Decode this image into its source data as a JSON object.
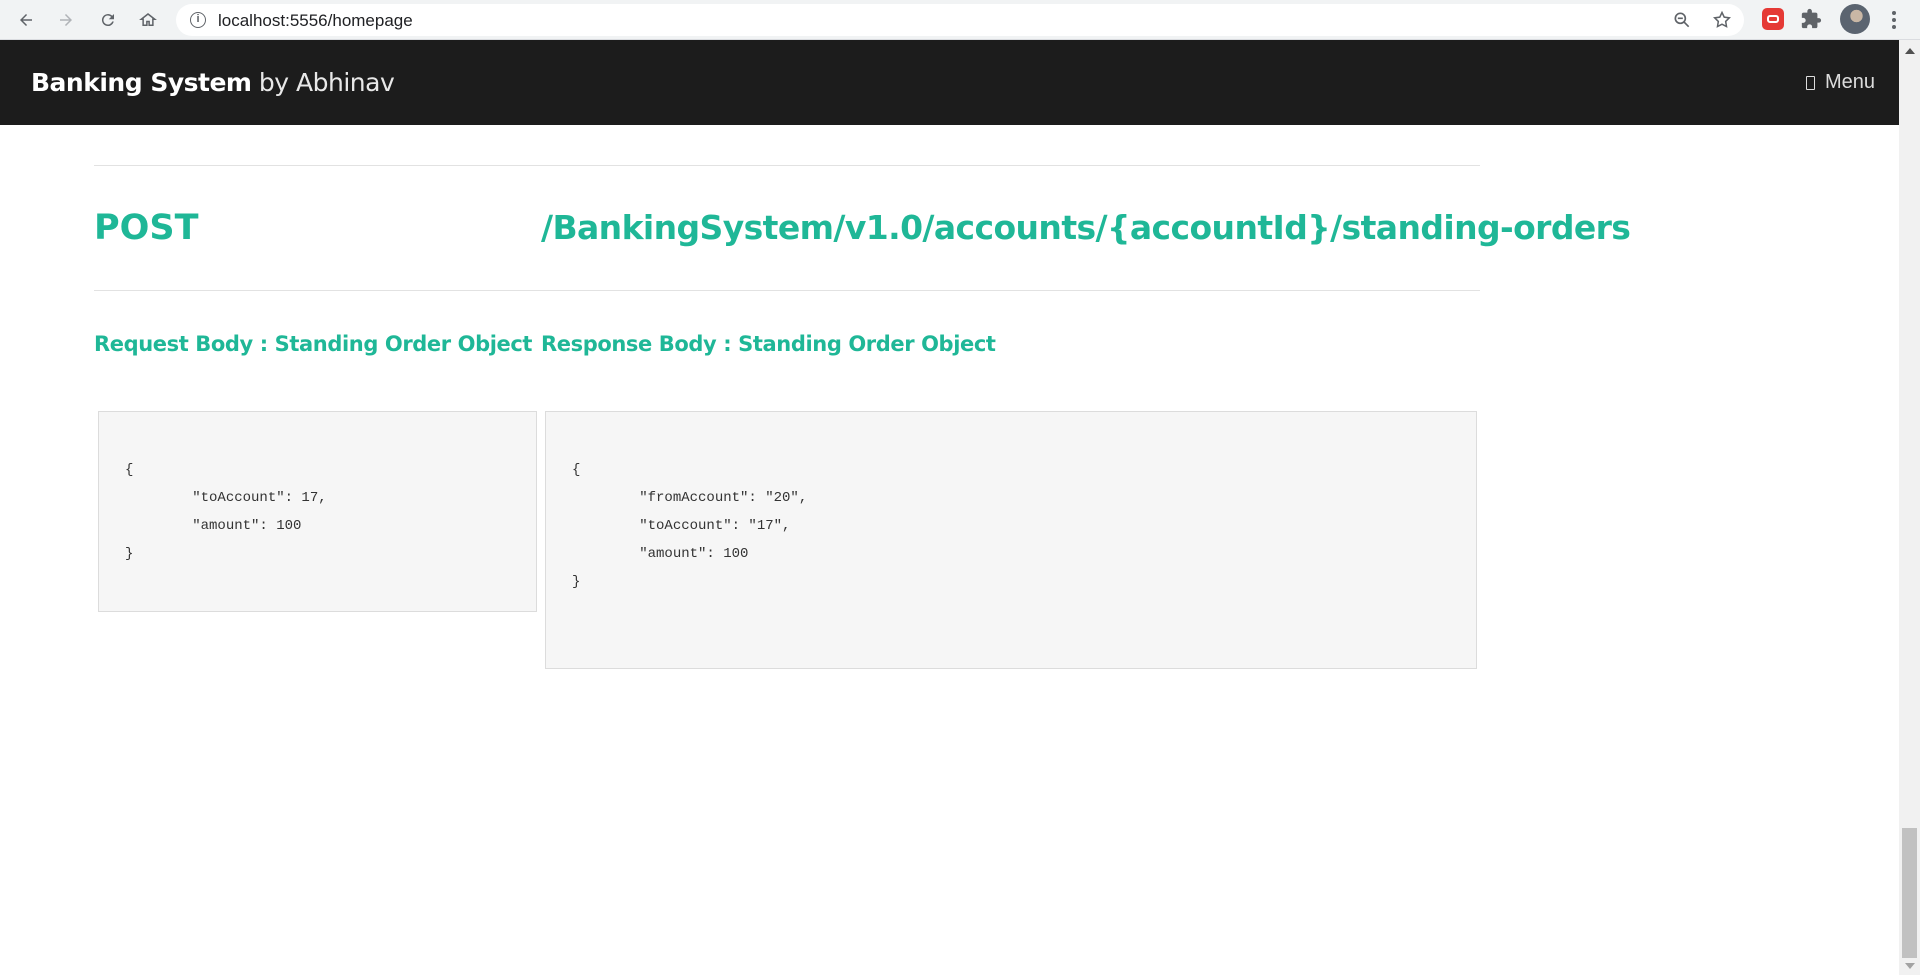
{
  "browser": {
    "url": "localhost:5556/homepage",
    "back_icon": "arrow-left-icon",
    "forward_icon": "arrow-right-icon",
    "reload_icon": "reload-icon",
    "home_icon": "home-icon"
  },
  "header": {
    "brand_bold": "Banking System",
    "brand_suffix": " by Abhinav",
    "menu_label": "Menu",
    "background": "#1c1c1c"
  },
  "endpoint": {
    "method": "POST",
    "path": "/BankingSystem/v1.0/accounts/{accountId}/standing-orders",
    "accent": "#1fb797"
  },
  "request": {
    "title": "Request Body : Standing Order Object",
    "body": "{\n        \"toAccount\": 17,\n        \"amount\": 100\n}"
  },
  "response": {
    "title": "Response Body : Standing Order Object",
    "body": "{\n        \"fromAccount\": \"20\",\n        \"toAccount\": \"17\",\n        \"amount\": 100\n}"
  }
}
